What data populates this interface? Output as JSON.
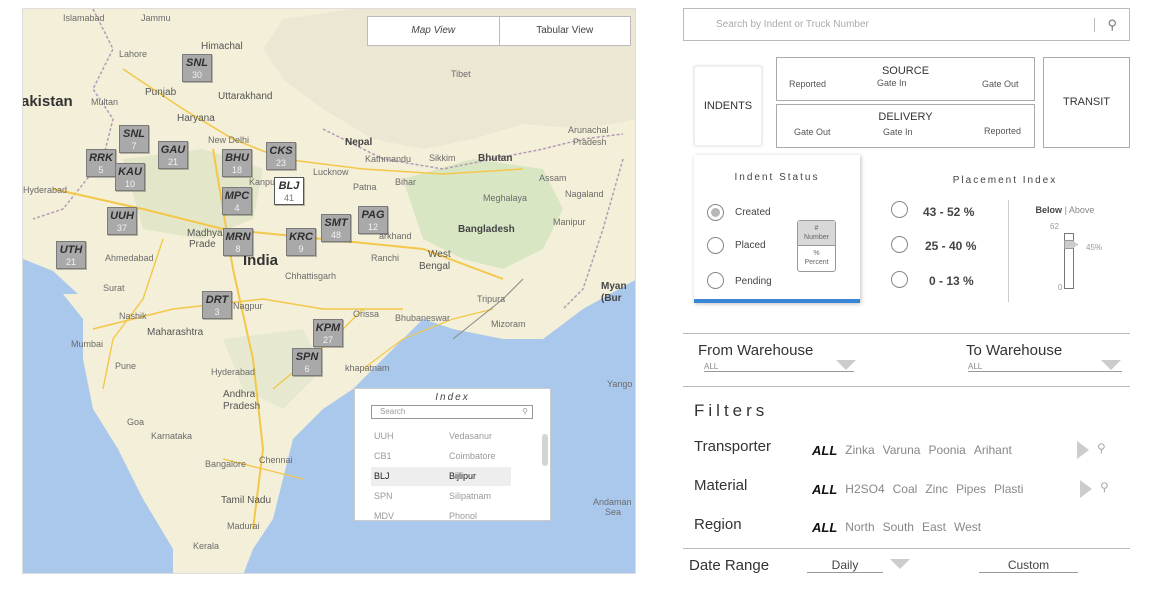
{
  "map": {
    "view_toggle": {
      "map_view": "Map View",
      "tabular_view": "Tabular View"
    },
    "labels": {
      "islamabad": "Islamabad",
      "jammu": "Jammu",
      "lahore": "Lahore",
      "himachal": "Himachal",
      "pakistan": "akistan",
      "multan": "Multan",
      "punjab": "Punjab",
      "uttarakhand": "Uttarakhand",
      "tibet": "Tibet",
      "haryana": "Haryana",
      "new_delhi": "New Delhi",
      "nepal": "Nepal",
      "kathmandu": "Kathmandu",
      "sikkim": "Sikkim",
      "bhutan": "Bhutan",
      "arunachal": "Arunachal",
      "pradesh_ne": "Pradesh",
      "kanpur": "Kanpur",
      "lucknow": "Lucknow",
      "assam": "Assam",
      "nagaland": "Nagaland",
      "hyderabad_pk": "Hyderabad",
      "patna": "Patna",
      "bihar": "Bihar",
      "meghalaya": "Meghalaya",
      "manipur": "Manipur",
      "bangladesh": "Bangladesh",
      "madhya": "Madhya",
      "pradesh_mp": "Prade",
      "jharkhand": "arkhand",
      "ahmedabad": "Ahmedabad",
      "india": "India",
      "ranchi": "Ranchi",
      "west": "West",
      "bengal": "Bengal",
      "chhattisgarh": "Chhattisgarh",
      "surat": "Surat",
      "nagpur": "Nagpur",
      "tripura": "Tripura",
      "mizoram": "Mizoram",
      "nashik": "Nashik",
      "maharashtra": "Maharashtra",
      "orissa": "Orissa",
      "bhubaneswar": "Bhubaneswar",
      "mumbai": "Mumbai",
      "pune": "Pune",
      "hyderabad": "Hyderabad",
      "visakhapatnam": "khapatnam",
      "andhra": "Andhra",
      "pradesh_ap": "Pradesh",
      "goa": "Goa",
      "karnataka": "Karnataka",
      "bangalore": "Bangalore",
      "chennai": "Chennai",
      "tamil_nadu": "Tamil Nadu",
      "madurai": "Madurai",
      "kerala": "Kerala",
      "myanmar": "Myan",
      "burma": "(Bur",
      "yangon": "Yango",
      "andaman": "Andaman",
      "sea": "Sea"
    },
    "pins": [
      {
        "code": "SNL",
        "num": "30",
        "active": false
      },
      {
        "code": "SNL",
        "num": "7",
        "active": false
      },
      {
        "code": "GAU",
        "num": "21",
        "active": false
      },
      {
        "code": "RRK",
        "num": "5",
        "active": false
      },
      {
        "code": "KAU",
        "num": "10",
        "active": false
      },
      {
        "code": "BHU",
        "num": "18",
        "active": false
      },
      {
        "code": "CKS",
        "num": "23",
        "active": false
      },
      {
        "code": "MPC",
        "num": "4",
        "active": false
      },
      {
        "code": "BLJ",
        "num": "41",
        "active": true
      },
      {
        "code": "UUH",
        "num": "37",
        "active": false
      },
      {
        "code": "SMT",
        "num": "48",
        "active": false
      },
      {
        "code": "PAG",
        "num": "12",
        "active": false
      },
      {
        "code": "MRN",
        "num": "8",
        "active": false
      },
      {
        "code": "KRC",
        "num": "9",
        "active": false
      },
      {
        "code": "UTH",
        "num": "21",
        "active": false
      },
      {
        "code": "DRT",
        "num": "3",
        "active": false
      },
      {
        "code": "KPM",
        "num": "27",
        "active": false
      },
      {
        "code": "SPN",
        "num": "6",
        "active": false
      }
    ],
    "index": {
      "title": "Index",
      "search_placeholder": "Search",
      "rows": [
        {
          "code": "UUH",
          "name": "Vedasanur"
        },
        {
          "code": "CB1",
          "name": "Coimbatore"
        },
        {
          "code": "BLJ",
          "name": "Bijlipur",
          "selected": true
        },
        {
          "code": "SPN",
          "name": "Silipatnam"
        },
        {
          "code": "MDV",
          "name": "Phonol"
        }
      ]
    }
  },
  "search": {
    "placeholder": "Search by Indent or Truck Number"
  },
  "stages": {
    "indents": "INDENTS",
    "source": {
      "title": "SOURCE",
      "reported": "Reported",
      "gate_in": "Gate In",
      "gate_out": "Gate Out"
    },
    "delivery": {
      "title": "DELIVERY",
      "gate_out": "Gate Out",
      "gate_in": "Gate In",
      "reported": "Reported"
    },
    "transit": "TRANSIT"
  },
  "indent_status": {
    "title": "Indent Status",
    "options": [
      "Created",
      "Placed",
      "Pending"
    ],
    "selected": "Created",
    "toggle_top": "#",
    "toggle_top_sub": "Number",
    "toggle_bottom": "%",
    "toggle_bottom_sub": "Percent",
    "accent": "#3a86d6"
  },
  "placement_index": {
    "title": "Placement Index",
    "ranges": [
      "43 - 52 %",
      "25 - 40 %",
      "0 - 13 %"
    ],
    "below": "Below",
    "sep": "|",
    "above": "Above",
    "slider_max": "62",
    "slider_min": "0",
    "slider_value": "45%"
  },
  "warehouse": {
    "from_label": "From Warehouse",
    "from_value": "ALL",
    "to_label": "To Warehouse",
    "to_value": "ALL"
  },
  "filters": {
    "title": "Filters",
    "transporter": {
      "label": "Transporter",
      "options": [
        "ALL",
        "Zinka",
        "Varuna",
        "Poonia",
        "Arihant"
      ]
    },
    "material": {
      "label": "Material",
      "options": [
        "ALL",
        "H2SO4",
        "Coal",
        "Zinc",
        "Pipes",
        "Plasti"
      ]
    },
    "region": {
      "label": "Region",
      "options": [
        "ALL",
        "North",
        "South",
        "East",
        "West"
      ]
    }
  },
  "date_range": {
    "label": "Date Range",
    "period": "Daily",
    "custom": "Custom"
  }
}
